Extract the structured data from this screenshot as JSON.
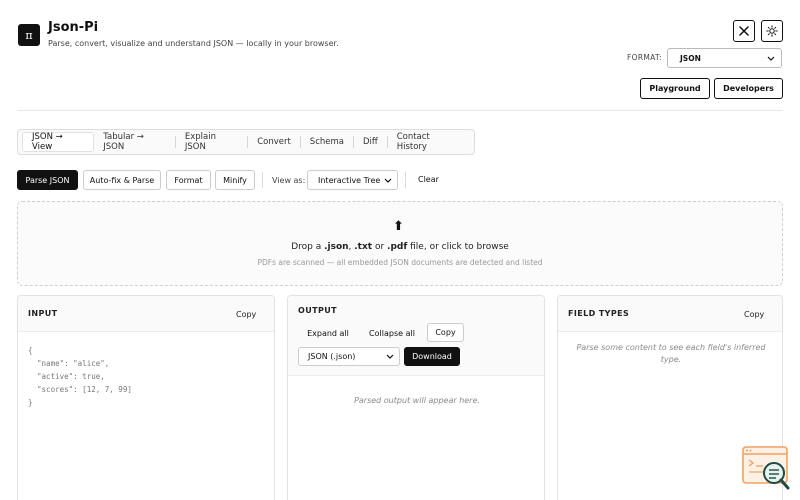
{
  "header": {
    "logo_glyph": "π",
    "title": "Json-Pi",
    "subtitle": "Parse, convert, visualize and understand JSON — locally in your browser.",
    "format_label": "FORMAT:",
    "format_value": "JSON",
    "playground_label": "Playground",
    "developers_label": "Developers",
    "close_icon": "close-icon",
    "theme_icon": "sun-icon"
  },
  "tabs": [
    {
      "label": "JSON → View",
      "active": true
    },
    {
      "label": "Tabular → JSON",
      "active": false
    },
    {
      "label": "Explain JSON",
      "active": false
    },
    {
      "label": "Convert",
      "active": false
    },
    {
      "label": "Schema",
      "active": false
    },
    {
      "label": "Diff",
      "active": false
    },
    {
      "label": "Contact History",
      "active": false
    }
  ],
  "toolbar": {
    "parse_label": "Parse JSON",
    "autofix_label": "Auto-fix & Parse",
    "format_label": "Format",
    "minify_label": "Minify",
    "view_as_label": "View as:",
    "view_as_value": "Interactive Tree",
    "clear_label": "Clear"
  },
  "dropzone": {
    "text_prefix": "Drop a ",
    "ext_json": ".json",
    "sep1": ", ",
    "ext_txt": ".txt",
    "sep2": " or ",
    "ext_pdf": ".pdf",
    "text_suffix": " file, or click to browse",
    "subtext": "PDFs are scanned — all embedded JSON documents are detected and listed"
  },
  "input_panel": {
    "title": "INPUT",
    "copy_label": "Copy",
    "code": "{\n  \"name\": \"alice\",\n  \"active\": true,\n  \"scores\": [12, 7, 99]\n}"
  },
  "output_panel": {
    "title": "OUTPUT",
    "expand_label": "Expand all",
    "collapse_label": "Collapse all",
    "copy_label": "Copy",
    "output_format_value": "JSON (.json)",
    "download_label": "Download",
    "placeholder": "Parsed output will appear here."
  },
  "types_panel": {
    "title": "FIELD TYPES",
    "copy_label": "Copy",
    "placeholder": "Parse some content to see each field's inferred type."
  },
  "colors": {
    "primary": "#111111",
    "border": "#e2e2e2",
    "widget_accent": "#f0a35e",
    "widget_dark": "#1f4a46"
  }
}
